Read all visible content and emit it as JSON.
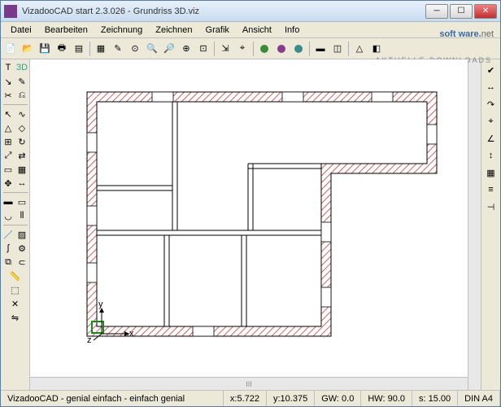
{
  "window": {
    "title": "VizadooCAD start 2.3.026  - Grundriss 3D.viz"
  },
  "menu": {
    "items": [
      "Datei",
      "Bearbeiten",
      "Zeichnung",
      "Zeichnen",
      "Grafik",
      "Ansicht",
      "Info"
    ]
  },
  "watermark": {
    "main": "soft ware.",
    "suffix": "net",
    "sub": "AKTUELLE DOWNLOADS"
  },
  "toolbar": {
    "icons": [
      "new",
      "open",
      "save",
      "print",
      "layer",
      "sep",
      "grid",
      "edit",
      "center",
      "zoomin",
      "zoomout",
      "zoom",
      "zoomfit",
      "sep",
      "export",
      "snap",
      "sep",
      "circle-green",
      "circle-purple",
      "circle-cyan",
      "sep",
      "wall",
      "door",
      "sep",
      "roof",
      "extra"
    ]
  },
  "leftbar": {
    "rows": [
      [
        "text-tool",
        "3d-toggle"
      ],
      [
        "link",
        "note"
      ],
      [
        "cut",
        "scissors"
      ],
      [
        "sep"
      ],
      [
        "arrow",
        "polyline"
      ],
      [
        "triangle",
        "shape"
      ],
      [
        "copy",
        "rotate"
      ],
      [
        "scale",
        "flip"
      ],
      [
        "rect",
        "grid"
      ],
      [
        "move",
        "dim"
      ],
      [
        "sep"
      ],
      [
        "wall",
        "wall2"
      ],
      [
        "arc",
        "columns"
      ],
      [
        "sep"
      ],
      [
        "brush",
        "hatch"
      ],
      [
        "curve",
        "cog"
      ],
      [
        "join",
        "magnet"
      ],
      [
        "measure",
        "blank"
      ],
      [
        "extrude",
        "blank"
      ],
      [
        "cross",
        "blank"
      ],
      [
        "mirror",
        "blank"
      ]
    ]
  },
  "rightbar": {
    "icons": [
      "check",
      "dim-h",
      "jump",
      "snap",
      "angle",
      "dim-v",
      "grid2",
      "bars",
      "end"
    ]
  },
  "axis": {
    "x": "x",
    "y": "y",
    "z": "z"
  },
  "status": {
    "info": "VizadooCAD - genial einfach - einfach genial",
    "x": "x:5.722",
    "y": "y:10.375",
    "gw": "GW: 0.0",
    "hw": "HW: 90.0",
    "s": "s: 15.00",
    "fmt": "DIN A4"
  }
}
